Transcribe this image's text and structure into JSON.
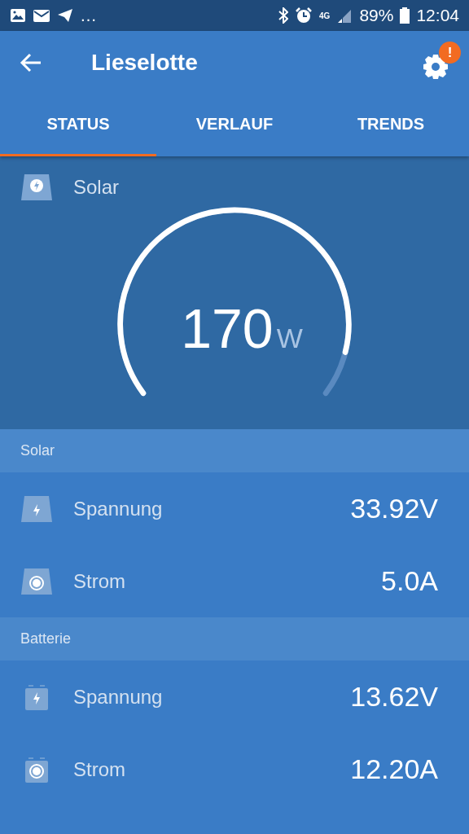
{
  "status_bar": {
    "overflow": "…",
    "network": "4G",
    "battery": "89%",
    "time": "12:04"
  },
  "app_bar": {
    "title": "Lieselotte",
    "badge": "!"
  },
  "tabs": [
    {
      "label": "STATUS",
      "selected": true
    },
    {
      "label": "VERLAUF",
      "selected": false
    },
    {
      "label": "TRENDS",
      "selected": false
    }
  ],
  "gauge": {
    "label": "Solar",
    "value": "170",
    "unit": "W"
  },
  "sections": [
    {
      "title": "Solar",
      "kind": "solar",
      "rows": [
        {
          "kind": "voltage",
          "label": "Spannung",
          "value": "33.92V"
        },
        {
          "kind": "current",
          "label": "Strom",
          "value": "5.0A"
        }
      ]
    },
    {
      "title": "Batterie",
      "kind": "battery",
      "rows": [
        {
          "kind": "voltage",
          "label": "Spannung",
          "value": "13.62V"
        },
        {
          "kind": "current",
          "label": "Strom",
          "value": "12.20A"
        }
      ]
    }
  ]
}
